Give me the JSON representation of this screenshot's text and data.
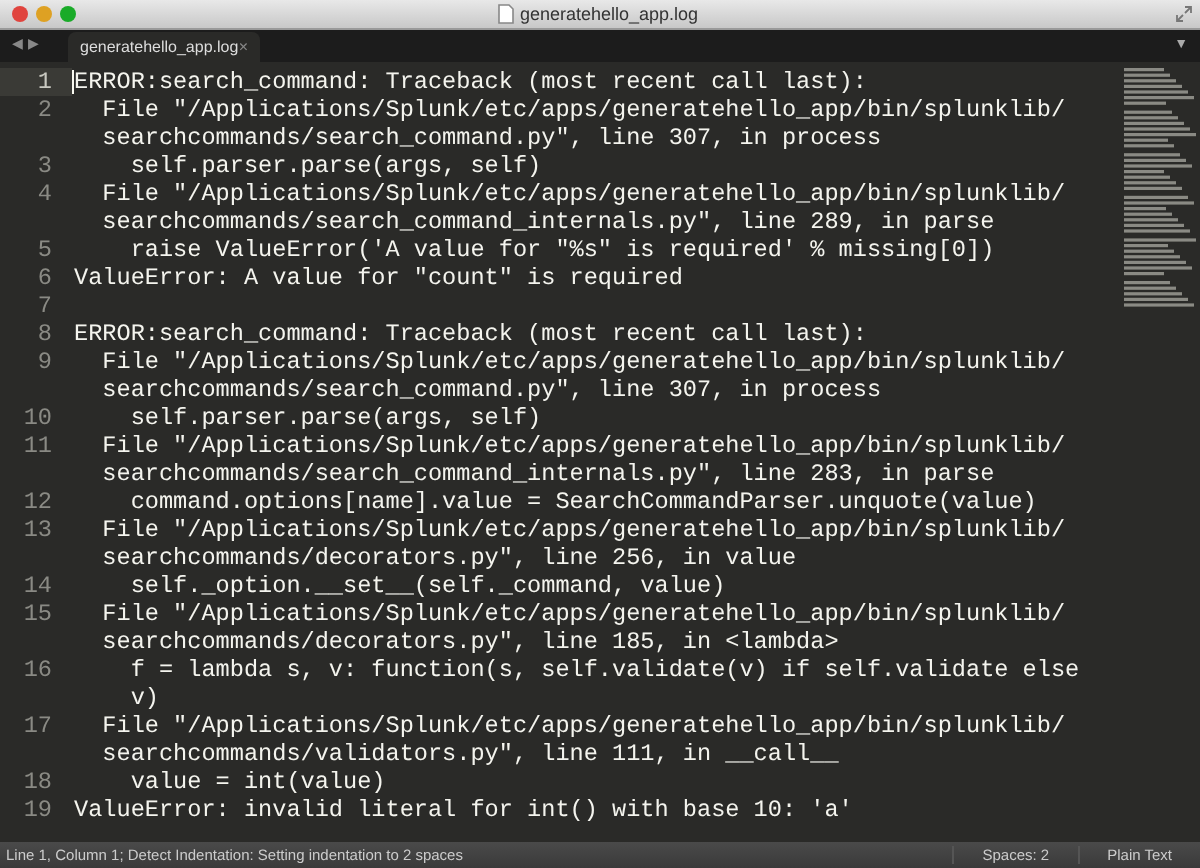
{
  "window": {
    "title": "generatehello_app.log"
  },
  "tabs": [
    {
      "label": "generatehello_app.log",
      "close": "×",
      "selected": true
    }
  ],
  "nav": {
    "back": "◀",
    "forward": "▶",
    "menu": "▼"
  },
  "lines": [
    {
      "number": "1",
      "current": true,
      "rows": [
        "ERROR:search_command: Traceback (most recent call last):"
      ]
    },
    {
      "number": "2",
      "current": false,
      "rows": [
        "  File \"/Applications/Splunk/etc/apps/generatehello_app/bin/splunklib/",
        "  searchcommands/search_command.py\", line 307, in process"
      ]
    },
    {
      "number": "3",
      "current": false,
      "rows": [
        "    self.parser.parse(args, self)"
      ]
    },
    {
      "number": "4",
      "current": false,
      "rows": [
        "  File \"/Applications/Splunk/etc/apps/generatehello_app/bin/splunklib/",
        "  searchcommands/search_command_internals.py\", line 289, in parse"
      ]
    },
    {
      "number": "5",
      "current": false,
      "rows": [
        "    raise ValueError('A value for \"%s\" is required' % missing[0])"
      ]
    },
    {
      "number": "6",
      "current": false,
      "rows": [
        "ValueError: A value for \"count\" is required"
      ]
    },
    {
      "number": "7",
      "current": false
    },
    {
      "number": "8",
      "current": false,
      "rows": [
        "ERROR:search_command: Traceback (most recent call last):"
      ]
    },
    {
      "number": "9",
      "current": false,
      "rows": [
        "  File \"/Applications/Splunk/etc/apps/generatehello_app/bin/splunklib/",
        "  searchcommands/search_command.py\", line 307, in process"
      ]
    },
    {
      "number": "10",
      "current": false,
      "rows": [
        "    self.parser.parse(args, self)"
      ]
    },
    {
      "number": "11",
      "current": false,
      "rows": [
        "  File \"/Applications/Splunk/etc/apps/generatehello_app/bin/splunklib/",
        "  searchcommands/search_command_internals.py\", line 283, in parse"
      ]
    },
    {
      "number": "12",
      "current": false,
      "rows": [
        "    command.options[name].value = SearchCommandParser.unquote(value)"
      ]
    },
    {
      "number": "13",
      "current": false,
      "rows": [
        "  File \"/Applications/Splunk/etc/apps/generatehello_app/bin/splunklib/",
        "  searchcommands/decorators.py\", line 256, in value"
      ]
    },
    {
      "number": "14",
      "current": false,
      "rows": [
        "    self._option.__set__(self._command, value)"
      ]
    },
    {
      "number": "15",
      "current": false,
      "rows": [
        "  File \"/Applications/Splunk/etc/apps/generatehello_app/bin/splunklib/",
        "  searchcommands/decorators.py\", line 185, in <lambda>"
      ]
    },
    {
      "number": "16",
      "current": false,
      "rows": [
        "    f = lambda s, v: function(s, self.validate(v) if self.validate else",
        "    v)"
      ]
    },
    {
      "number": "17",
      "current": false,
      "rows": [
        "  File \"/Applications/Splunk/etc/apps/generatehello_app/bin/splunklib/",
        "  searchcommands/validators.py\", line 111, in __call__"
      ]
    },
    {
      "number": "18",
      "current": false,
      "rows": [
        "    value = int(value)"
      ]
    },
    {
      "number": "19",
      "current": false,
      "rows": [
        "ValueError: invalid literal for int() with base 10: 'a'"
      ]
    }
  ],
  "status_bar": {
    "message": "Line 1, Column 1; Detect Indentation: Setting indentation to 2 spaces",
    "indentation": "Spaces: 2",
    "syntax": "Plain Text"
  }
}
